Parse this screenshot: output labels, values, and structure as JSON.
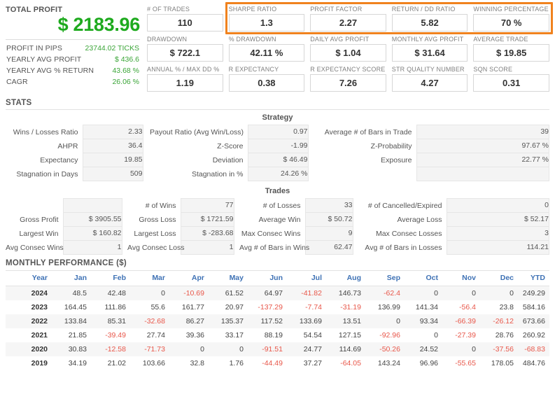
{
  "summary": {
    "title": "TOTAL PROFIT",
    "amount": "$ 2183.96",
    "rows": [
      {
        "label": "PROFIT IN PIPS",
        "value": "23744.02 TICKS"
      },
      {
        "label": "YEARLY AVG PROFIT",
        "value": "$ 436.6"
      },
      {
        "label": "YEARLY AVG % RETURN",
        "value": "43.68 %"
      },
      {
        "label": "CAGR",
        "value": "26.06 %"
      }
    ],
    "accent_color": "#1eaa1e"
  },
  "metrics": {
    "highlight_color": "#f0821e",
    "rows": [
      [
        {
          "label": "# OF TRADES",
          "value": "110"
        },
        {
          "label": "SHARPE RATIO",
          "value": "1.3"
        },
        {
          "label": "PROFIT FACTOR",
          "value": "2.27"
        },
        {
          "label": "RETURN / DD RATIO",
          "value": "5.82"
        },
        {
          "label": "WINNING PERCENTAGE",
          "value": "70 %"
        }
      ],
      [
        {
          "label": "DRAWDOWN",
          "value": "$ 722.1"
        },
        {
          "label": "% DRAWDOWN",
          "value": "42.11 %"
        },
        {
          "label": "DAILY AVG PROFIT",
          "value": "$ 1.04"
        },
        {
          "label": "MONTHLY AVG PROFIT",
          "value": "$ 31.64"
        },
        {
          "label": "AVERAGE TRADE",
          "value": "$ 19.85"
        }
      ],
      [
        {
          "label": "ANNUAL % / MAX DD %",
          "value": "1.19"
        },
        {
          "label": "R EXPECTANCY",
          "value": "0.38"
        },
        {
          "label": "R EXPECTANCY SCORE",
          "value": "7.26"
        },
        {
          "label": "STR QUALITY NUMBER",
          "value": "4.27"
        },
        {
          "label": "SQN SCORE",
          "value": "0.31"
        }
      ]
    ]
  },
  "stats": {
    "heading": "STATS",
    "strategy": {
      "title": "Strategy",
      "rows": [
        [
          {
            "label": "Wins / Losses Ratio",
            "value": "2.33"
          },
          {
            "label": "Payout Ratio (Avg Win/Loss)",
            "value": "0.97"
          },
          {
            "label": "Average # of Bars in Trade",
            "value": "39"
          }
        ],
        [
          {
            "label": "AHPR",
            "value": "36.4"
          },
          {
            "label": "Z-Score",
            "value": "-1.99"
          },
          {
            "label": "Z-Probability",
            "value": "97.67 %"
          }
        ],
        [
          {
            "label": "Expectancy",
            "value": "19.85"
          },
          {
            "label": "Deviation",
            "value": "$ 46.49"
          },
          {
            "label": "Exposure",
            "value": "22.77 %"
          }
        ],
        [
          {
            "label": "Stagnation in Days",
            "value": "509"
          },
          {
            "label": "Stagnation in %",
            "value": "24.26 %"
          },
          {
            "label": "",
            "value": ""
          }
        ]
      ]
    },
    "trades": {
      "title": "Trades",
      "rows": [
        [
          {
            "label": "",
            "value": ""
          },
          {
            "label": "# of Wins",
            "value": "77"
          },
          {
            "label": "# of Losses",
            "value": "33"
          },
          {
            "label": "# of Cancelled/Expired",
            "value": "0"
          }
        ],
        [
          {
            "label": "Gross Profit",
            "value": "$ 3905.55"
          },
          {
            "label": "Gross Loss",
            "value": "$ 1721.59"
          },
          {
            "label": "Average Win",
            "value": "$ 50.72"
          },
          {
            "label": "Average Loss",
            "value": "$ 52.17"
          }
        ],
        [
          {
            "label": "Largest Win",
            "value": "$ 160.82"
          },
          {
            "label": "Largest Loss",
            "value": "$ -283.68"
          },
          {
            "label": "Max Consec Wins",
            "value": "9"
          },
          {
            "label": "Max Consec Losses",
            "value": "3"
          }
        ],
        [
          {
            "label": "Avg Consec Wins",
            "value": "1"
          },
          {
            "label": "Avg Consec Loss",
            "value": "1"
          },
          {
            "label": "Avg # of Bars in Wins",
            "value": "62.47"
          },
          {
            "label": "Avg # of Bars in Losses",
            "value": "114.21"
          }
        ]
      ]
    }
  },
  "monthly": {
    "heading": "MONTHLY PERFORMANCE ($)",
    "columns": [
      "Year",
      "Jan",
      "Feb",
      "Mar",
      "Apr",
      "May",
      "Jun",
      "Jul",
      "Aug",
      "Sep",
      "Oct",
      "Nov",
      "Dec",
      "YTD"
    ],
    "negative_color": "#e8574a",
    "header_color": "#3f72b5",
    "rows": [
      {
        "year": "2024",
        "values": [
          "48.5",
          "42.48",
          "0",
          "-10.69",
          "61.52",
          "64.97",
          "-41.82",
          "146.73",
          "-62.4",
          "0",
          "0",
          "0",
          "249.29"
        ]
      },
      {
        "year": "2023",
        "values": [
          "164.45",
          "111.86",
          "55.6",
          "161.77",
          "20.97",
          "-137.29",
          "-7.74",
          "-31.19",
          "136.99",
          "141.34",
          "-56.4",
          "23.8",
          "584.16"
        ]
      },
      {
        "year": "2022",
        "values": [
          "133.84",
          "85.31",
          "-32.68",
          "86.27",
          "135.37",
          "117.52",
          "133.69",
          "13.51",
          "0",
          "93.34",
          "-66.39",
          "-26.12",
          "673.66"
        ]
      },
      {
        "year": "2021",
        "values": [
          "21.85",
          "-39.49",
          "27.74",
          "39.36",
          "33.17",
          "88.19",
          "54.54",
          "127.15",
          "-92.96",
          "0",
          "-27.39",
          "28.76",
          "260.92"
        ]
      },
      {
        "year": "2020",
        "values": [
          "30.83",
          "-12.58",
          "-71.73",
          "0",
          "0",
          "-91.51",
          "24.77",
          "114.69",
          "-50.26",
          "24.52",
          "0",
          "-37.56",
          "-68.83"
        ]
      },
      {
        "year": "2019",
        "values": [
          "34.19",
          "21.02",
          "103.66",
          "32.8",
          "1.76",
          "-44.49",
          "37.27",
          "-64.05",
          "143.24",
          "96.96",
          "-55.65",
          "178.05",
          "484.76"
        ]
      }
    ]
  }
}
